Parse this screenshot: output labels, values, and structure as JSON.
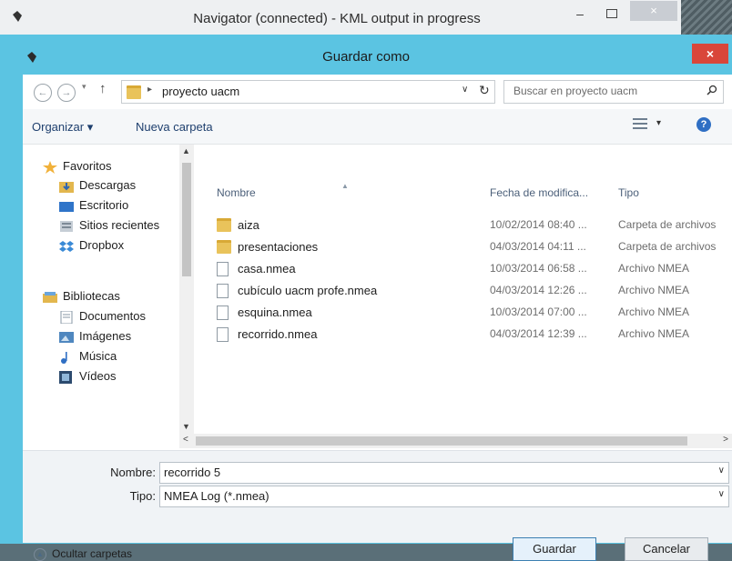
{
  "back_window": {
    "title": "Navigator (connected) - KML output in progress",
    "minimize": "–",
    "close": "×"
  },
  "dialog": {
    "title": "Guardar como",
    "close": "×"
  },
  "address": {
    "path": "proyecto uacm",
    "separator": "▸",
    "search_placeholder": "Buscar en proyecto uacm"
  },
  "toolbar": {
    "organize": "Organizar ▾",
    "new_folder": "Nueva carpeta",
    "view_dd": "▾",
    "help": "?"
  },
  "nav_pane": {
    "favorites_label": "Favoritos",
    "favorites": [
      "Descargas",
      "Escritorio",
      "Sitios recientes",
      "Dropbox"
    ],
    "libraries_label": "Bibliotecas",
    "libraries": [
      "Documentos",
      "Imágenes",
      "Música",
      "Vídeos"
    ]
  },
  "columns": {
    "name": "Nombre",
    "date": "Fecha de modifica...",
    "type": "Tipo"
  },
  "files": [
    {
      "name": "aiza",
      "date": "10/02/2014 08:40 ...",
      "type": "Carpeta de archivos",
      "kind": "folder"
    },
    {
      "name": "presentaciones",
      "date": "04/03/2014 04:11 ...",
      "type": "Carpeta de archivos",
      "kind": "folder"
    },
    {
      "name": "casa.nmea",
      "date": "10/03/2014 06:58 ...",
      "type": "Archivo NMEA",
      "kind": "file"
    },
    {
      "name": "cubículo uacm profe.nmea",
      "date": "04/03/2014 12:26 ...",
      "type": "Archivo NMEA",
      "kind": "file"
    },
    {
      "name": "esquina.nmea",
      "date": "10/03/2014 07:00 ...",
      "type": "Archivo NMEA",
      "kind": "file"
    },
    {
      "name": "recorrido.nmea",
      "date": "04/03/2014 12:39 ...",
      "type": "Archivo NMEA",
      "kind": "file"
    }
  ],
  "form": {
    "name_label": "Nombre:",
    "name_value": "recorrido 5",
    "type_label": "Tipo:",
    "type_value": "NMEA Log (*.nmea)"
  },
  "buttons": {
    "hide_folders": "Ocultar carpetas",
    "save": "Guardar",
    "cancel": "Cancelar"
  },
  "colors": {
    "dialog_frame": "#5bc4e2",
    "close_red": "#d9463a",
    "folder": "#e9c35b"
  }
}
